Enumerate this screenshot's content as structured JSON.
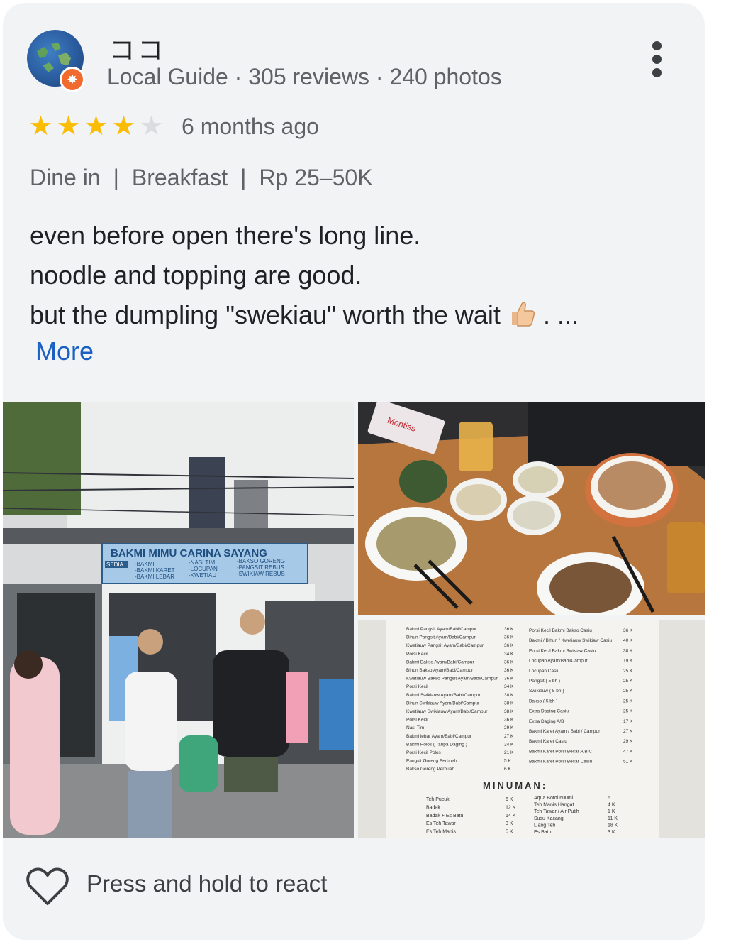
{
  "review": {
    "author": {
      "name": "ココ",
      "meta": "Local Guide · 305 reviews · 240 photos",
      "avatar_icon": "globe-avatar-icon",
      "badge_icon": "local-guide-badge-icon"
    },
    "rating": 4,
    "max_rating": 5,
    "age": "6 months ago",
    "tags": [
      "Dine in",
      "Breakfast",
      "Rp 25–50K"
    ],
    "tag_separator": "|",
    "text_lines": [
      "even before open there's long line.",
      "noodle and topping are good.",
      "but the dumpling \"swekiau\" worth the wait"
    ],
    "text_tail": ". ...",
    "text_emoji": "thumbs-up-icon",
    "more_label": "More"
  },
  "photos": {
    "shop_sign": {
      "title": "BAKMI MIMU CARINA SAYANG",
      "sedia": "SEDIA",
      "col1": [
        "-BAKMI",
        "-BAKMI KARET",
        "-BAKMI LEBAR"
      ],
      "col2": [
        "-NASI TIM",
        "-LOCUPAN",
        "-KWETIAU"
      ],
      "col3": [
        "-BAKSO GORENG",
        "-PANGSIT REBUS",
        "-SWIKIAW REBUS"
      ]
    },
    "menu": {
      "heading": "MINUMAN:",
      "left_items": [
        [
          "Bakmi Pangsit Ayam/Babi/Campur",
          "36 K"
        ],
        [
          "Bihun Pangsit Ayam/Babi/Campur",
          "36 K"
        ],
        [
          "Kwetiauw Pangsit Ayam/Babi/Campur",
          "36 K"
        ],
        [
          "Porsi Kecil",
          "34 K"
        ],
        [
          "Bakmi Bakso Ayam/Babi/Campur",
          "36 K"
        ],
        [
          "Bihun Bakso Ayam/Babi/Campur",
          "36 K"
        ],
        [
          "Kwetiauw Bakso Pangsit Ayam/Babi/Campur",
          "36 K"
        ],
        [
          "Porsi Kecil",
          "34 K"
        ],
        [
          "Bakmi Swikiauw Ayam/Babi/Campur",
          "38 K"
        ],
        [
          "Bihun Swikiauw Ayam/Babi/Campur",
          "38 K"
        ],
        [
          "Kwetiauw Swikiauw Ayam/Babi/Campur",
          "38 K"
        ],
        [
          "Porsi Kecil",
          "36 K"
        ],
        [
          "Nasi Tim",
          "29 K"
        ],
        [
          "Bakmi lebar Ayam/Babi/Campur",
          "27 K"
        ],
        [
          "Bakmi Polos ( Tanpa Daging )",
          "24 K"
        ],
        [
          "Porsi Kecil Polos",
          "21 K"
        ],
        [
          "Pangsit Goreng Perbuah",
          "5 K"
        ],
        [
          "Bakso Goreng Perbuah",
          "6 K"
        ]
      ],
      "right_items": [
        [
          "Porsi Kecil Bakmi Bakso Casiu",
          "36 K"
        ],
        [
          "Bakmi / Bihun / Kwetiauw Swikiaw Casiu",
          "40 K"
        ],
        [
          "Porsi Kecil Bakmi Swikiaw Casiu",
          "38 K"
        ],
        [
          "Locupan Ayam/Babi/Campur",
          "19 K"
        ],
        [
          "Locupan Casiu",
          "25 K"
        ],
        [
          "Pangsit ( 5 bh )",
          "25 K"
        ],
        [
          "Swikiauw ( 5 bh )",
          "25 K"
        ],
        [
          "Bakso ( 5 bh )",
          "25 K"
        ],
        [
          "Extra Daging Casiu",
          "25 K"
        ],
        [
          "Extra Daging A/B",
          "17 K"
        ],
        [
          "Bakmi Karet Ayam / Babi / Campur",
          "27 K"
        ],
        [
          "Bakmi Karet Casiu",
          "29 K"
        ],
        [
          "Bakmi Karet Porsi Besar A/B/C",
          "47 K"
        ],
        [
          "Bakmi Karet Porsi Besar Casiu",
          "51 K"
        ]
      ],
      "drinks_left": [
        [
          "Teh Pucuk",
          "6 K"
        ],
        [
          "Badak",
          "12 K"
        ],
        [
          "Badak + Es Batu",
          "14 K"
        ],
        [
          "Es Teh Tawar",
          "3 K"
        ],
        [
          "Es Teh Manis",
          "5 K"
        ]
      ],
      "drinks_right": [
        [
          "Aqua Botol 600ml",
          "6"
        ],
        [
          "Teh Manis Hangat",
          "4 K"
        ],
        [
          "Teh Tawar / Air Putih",
          "1 K"
        ],
        [
          "Susu Kacang",
          "11 K"
        ],
        [
          "Liang Teh",
          "18 K"
        ],
        [
          "Es Batu",
          "3 K"
        ]
      ]
    },
    "tissue_brand": "Montiss"
  },
  "footer": {
    "react_label": "Press and hold to react",
    "react_icon": "heart-outline-icon"
  },
  "colors": {
    "card_bg": "#f2f3f5",
    "star_on": "#fbbc04",
    "star_off": "#dadce0",
    "link": "#1a5fc4",
    "badge": "#f16b2e"
  }
}
